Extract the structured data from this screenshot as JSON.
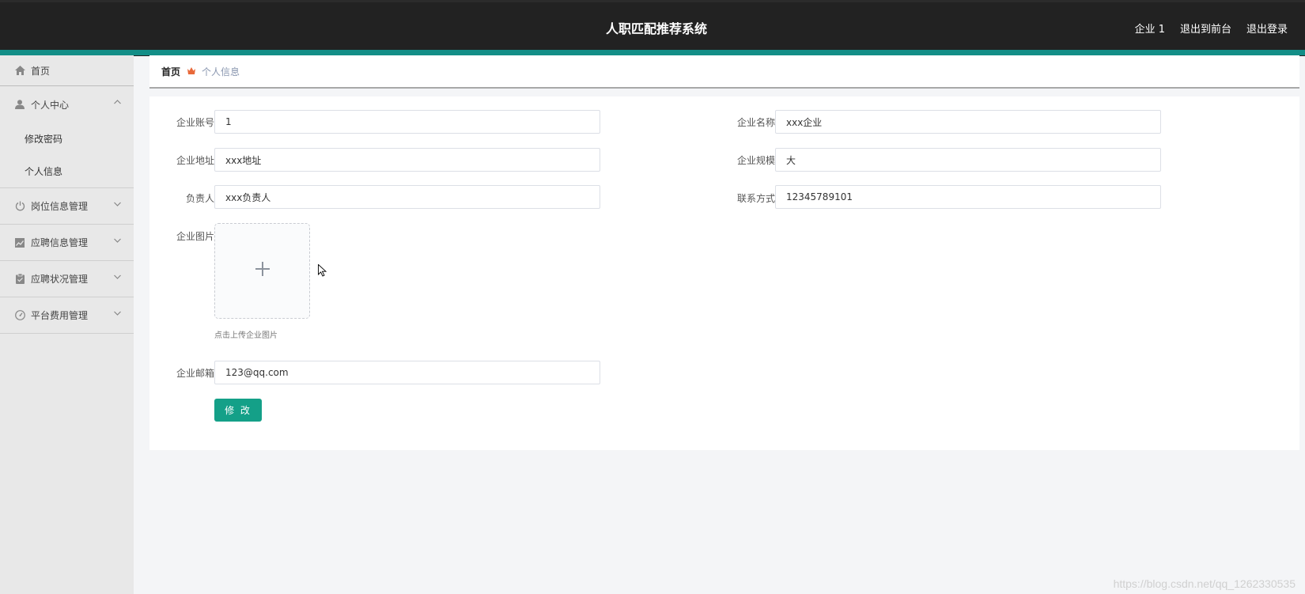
{
  "header": {
    "title": "人职匹配推荐系统",
    "user": "企业 1",
    "back_front": "退出到前台",
    "logout": "退出登录"
  },
  "sidebar": {
    "home": "首页",
    "personal_center": "个人中心",
    "change_password": "修改密码",
    "personal_info": "个人信息",
    "job_info": "岗位信息管理",
    "application_info": "应聘信息管理",
    "application_status": "应聘状况管理",
    "platform_fee": "平台费用管理"
  },
  "breadcrumb": {
    "home": "首页",
    "current": "个人信息"
  },
  "form": {
    "account_label": "企业账号",
    "account_value": "1",
    "name_label": "企业名称",
    "name_value": "xxx企业",
    "address_label": "企业地址",
    "address_value": "xxx地址",
    "scale_label": "企业规模",
    "scale_value": "大",
    "manager_label": "负责人",
    "manager_value": "xxx负责人",
    "contact_label": "联系方式",
    "contact_value": "12345789101",
    "image_label": "企业图片",
    "upload_tip": "点击上传企业图片",
    "email_label": "企业邮箱",
    "email_value": "123@qq.com",
    "submit_label": "修 改"
  },
  "watermark": "https://blog.csdn.net/qq_1262330535",
  "colors": {
    "header_bg": "#222222",
    "accent": "#138e87",
    "button": "#14a088"
  }
}
